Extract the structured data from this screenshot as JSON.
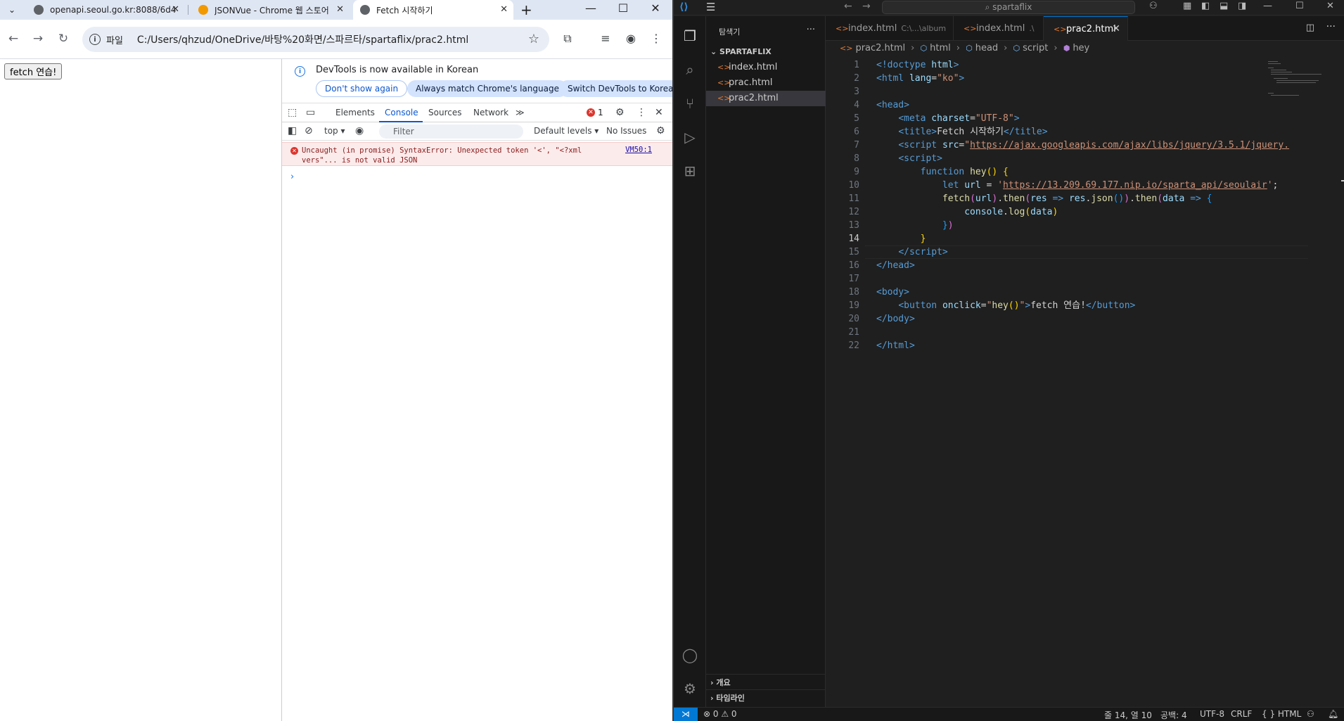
{
  "chrome": {
    "tabs": [
      {
        "title": "openapi.seoul.go.kr:8088/6d4",
        "favicon_color": "#5f6368"
      },
      {
        "title": "JSONVue - Chrome 웹 스토어",
        "favicon_color": "#f29900"
      },
      {
        "title": "Fetch 시작하기",
        "favicon_color": "#5f6368"
      }
    ],
    "address": {
      "scheme_label": "파일",
      "url": "C:/Users/qhzud/OneDrive/바탕%20화면/스파르타/spartaflix/prac2.html"
    },
    "page": {
      "button_label": "fetch 연습!"
    },
    "devtools": {
      "banner": {
        "message": "DevTools is now available in Korean",
        "btn_dont_show": "Don't show again",
        "btn_match": "Always match Chrome's language",
        "btn_switch": "Switch DevTools to Korean"
      },
      "tabs": [
        "Elements",
        "Console",
        "Sources",
        "Network"
      ],
      "active_tab": "Console",
      "error_count": "1",
      "filter": {
        "context": "top ▾",
        "placeholder": "Filter",
        "levels": "Default levels ▾",
        "issues": "No Issues"
      },
      "console_error": {
        "text": "Uncaught (in promise) SyntaxError: Unexpected token '<', \"<?xml vers\"... is not valid JSON",
        "source": "VM50:1"
      }
    }
  },
  "vscode": {
    "search": "spartaflix",
    "explorer": {
      "title": "탐색기",
      "folder": "SPARTAFLIX",
      "files": [
        "index.html",
        "prac.html",
        "prac2.html"
      ],
      "selected": "prac2.html",
      "sections": [
        "개요",
        "타임라인"
      ]
    },
    "tabs": [
      {
        "name": "index.html",
        "desc": "C:\\...\\album"
      },
      {
        "name": "index.html",
        "desc": ".\\"
      },
      {
        "name": "prac2.html",
        "desc": ""
      }
    ],
    "breadcrumb": [
      "prac2.html",
      "html",
      "head",
      "script",
      "hey"
    ],
    "cursor_line": 14,
    "status": {
      "errors": "0",
      "warnings": "0",
      "position": "줄 14, 열 10",
      "spaces": "공백: 4",
      "encoding": "UTF-8",
      "eol": "CRLF",
      "language": "HTML"
    },
    "code_lines": 22
  }
}
